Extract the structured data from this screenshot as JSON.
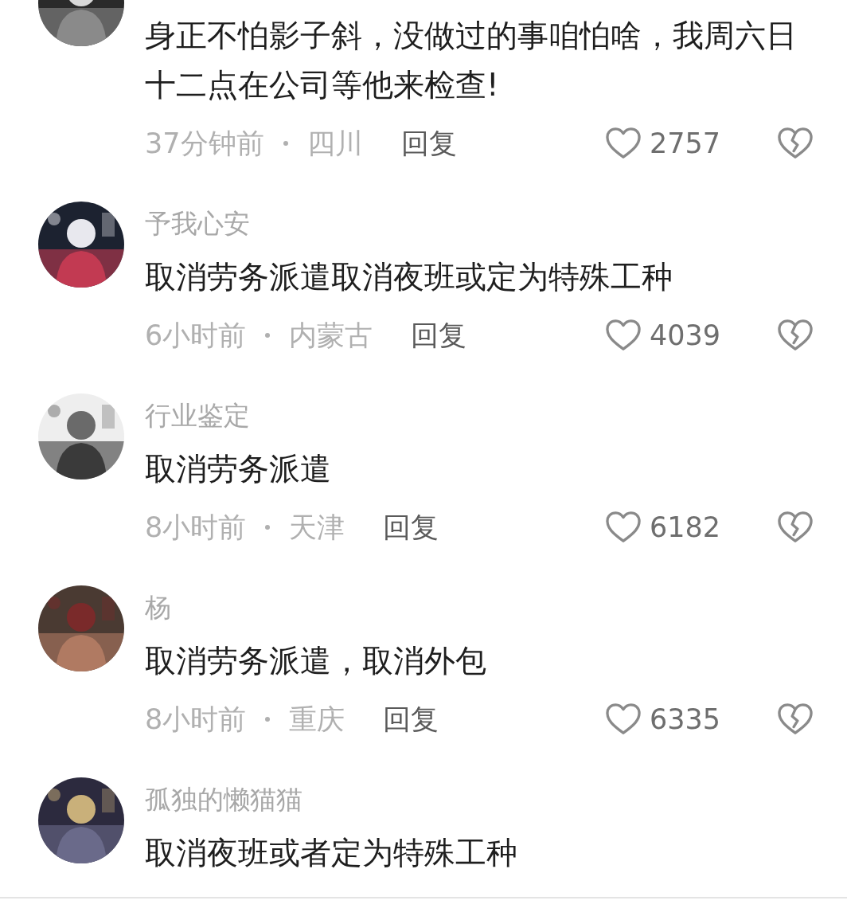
{
  "comments": [
    {
      "text": "身正不怕影子斜，没做过的事咱怕啥，我周六日十二点在公司等他来检查!",
      "time": "37分钟前",
      "location": "四川",
      "reply": "回复",
      "likes": "2757"
    },
    {
      "name": "予我心安",
      "text": "取消劳务派遣取消夜班或定为特殊工种",
      "time": "6小时前",
      "location": "内蒙古",
      "reply": "回复",
      "likes": "4039"
    },
    {
      "name": "行业鉴定",
      "text": "取消劳务派遣",
      "time": "8小时前",
      "location": "天津",
      "reply": "回复",
      "likes": "6182"
    },
    {
      "name": "杨",
      "text": "取消劳务派遣，取消外包",
      "time": "8小时前",
      "location": "重庆",
      "reply": "回复",
      "likes": "6335"
    },
    {
      "name": "孤独的懒猫猫",
      "text": "取消夜班或者定为特殊工种"
    }
  ]
}
